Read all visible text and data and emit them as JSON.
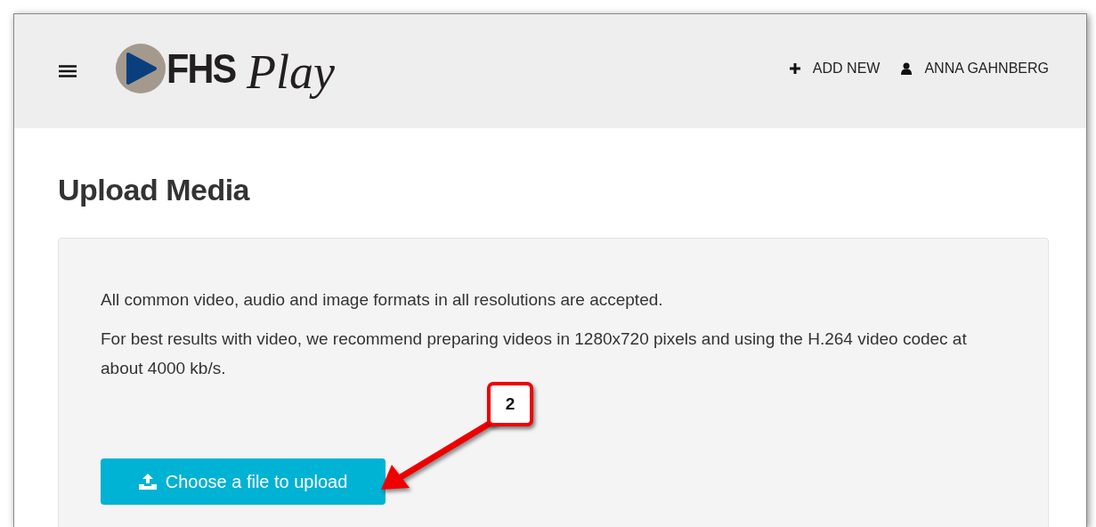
{
  "header": {
    "logo": {
      "brand": "FHS",
      "product": "Play"
    },
    "nav": [
      {
        "kind": "add",
        "label": "ADD NEW"
      },
      {
        "kind": "user",
        "label": "ANNA GAHNBERG"
      }
    ]
  },
  "page_title": "Upload Media",
  "panel": {
    "paragraphs": [
      "All common video, audio and image formats in all resolutions are accepted.",
      "For best results with video, we recommend preparing videos in 1280x720 pixels and using the H.264 video codec at about 4000 kb/s."
    ],
    "upload_button": {
      "label": "Choose a file to upload"
    }
  },
  "annotation": {
    "label": "2"
  }
}
